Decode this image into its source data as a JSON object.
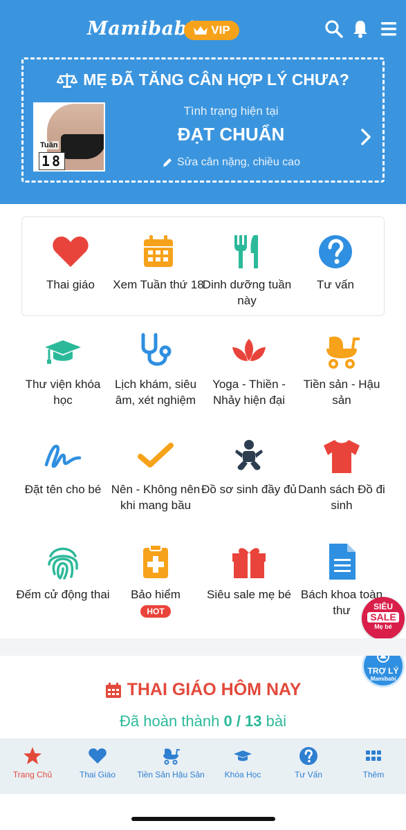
{
  "header": {
    "logo": "Mamibabi",
    "vip_label": "VIP",
    "colors": {
      "primary": "#3b95de",
      "vip": "#f6a21a"
    }
  },
  "weight_card": {
    "title": "MẸ ĐÃ TĂNG CÂN HỢP LÝ CHƯA?",
    "week_label": "Tuần",
    "week_number": "18",
    "status_label": "Tình trạng hiện tại",
    "status_value": "ĐẠT CHUẨN",
    "edit_label": "Sửa cân nặng, chiều cao"
  },
  "quick_actions": [
    {
      "label": "Thai giáo",
      "icon": "heart-icon"
    },
    {
      "label": "Xem Tuần thứ 18",
      "icon": "calendar-icon"
    },
    {
      "label": "Dinh dưỡng tuần này",
      "icon": "utensils-icon"
    },
    {
      "label": "Tư vấn",
      "icon": "question-icon"
    }
  ],
  "features": [
    {
      "label": "Thư viện khóa học",
      "icon": "graduation-cap-icon"
    },
    {
      "label": "Lịch khám, siêu âm, xét nghiệm",
      "icon": "stethoscope-icon"
    },
    {
      "label": "Yoga - Thiền - Nhảy hiện đại",
      "icon": "lotus-icon"
    },
    {
      "label": "Tiền sản - Hậu sản",
      "icon": "stroller-icon"
    },
    {
      "label": "Đặt tên cho bé",
      "icon": "signature-icon"
    },
    {
      "label": "Nên - Không nên khi mang bầu",
      "icon": "check-icon"
    },
    {
      "label": "Đồ sơ sinh đầy đủ",
      "icon": "baby-icon"
    },
    {
      "label": "Danh sách Đồ đi sinh",
      "icon": "shirt-icon"
    },
    {
      "label": "Đếm cử động thai",
      "icon": "fingerprint-icon"
    },
    {
      "label": "Bảo hiểm",
      "icon": "medical-clipboard-icon",
      "badge": "HOT"
    },
    {
      "label": "Siêu sale mẹ bé",
      "icon": "gift-icon"
    },
    {
      "label": "Bách khoa toàn thư",
      "icon": "document-icon"
    }
  ],
  "floating": {
    "sale_line1": "SIÊU",
    "sale_line2": "SALE",
    "sale_line3": "Mẹ bé",
    "assistant_line1": "TRỢ LÝ",
    "assistant_line2": "Mamibabi"
  },
  "today": {
    "title": "THAI GIÁO HÔM NAY",
    "progress_prefix": "Đã hoàn thành",
    "progress_value": "0 / 13",
    "progress_suffix": "bài"
  },
  "bottom_nav": [
    {
      "label": "Trang Chủ",
      "icon": "star-icon",
      "active": true
    },
    {
      "label": "Thai Giáo",
      "icon": "heart-icon",
      "active": false
    },
    {
      "label": "Tiền Sản Hậu Sản",
      "icon": "stroller-icon",
      "active": false
    },
    {
      "label": "Khóa Học",
      "icon": "graduation-cap-icon",
      "active": false
    },
    {
      "label": "Tư Vấn",
      "icon": "question-icon",
      "active": false
    },
    {
      "label": "Thêm",
      "icon": "grid-icon",
      "active": false
    }
  ]
}
